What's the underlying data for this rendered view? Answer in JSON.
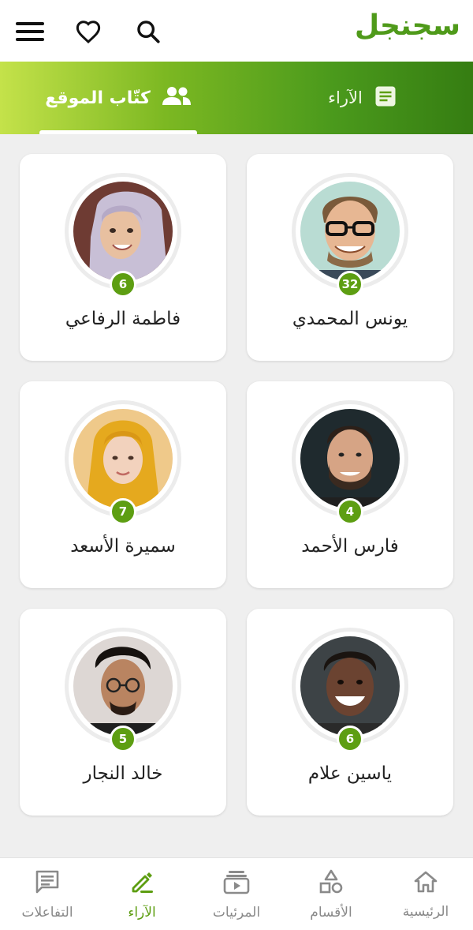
{
  "header": {
    "logo_text": "سجنجل",
    "icons": [
      "search-icon",
      "heart-icon",
      "menu-icon"
    ]
  },
  "tabs": [
    {
      "label": "الآراء",
      "icon": "article-icon",
      "active": false
    },
    {
      "label": "كتّاب الموقع",
      "icon": "people-icon",
      "active": true
    }
  ],
  "writers": [
    {
      "name": "يونس المحمدي",
      "count": "32"
    },
    {
      "name": "فاطمة الرفاعي",
      "count": "6"
    },
    {
      "name": "فارس الأحمد",
      "count": "4"
    },
    {
      "name": "سميرة الأسعد",
      "count": "7"
    },
    {
      "name": "ياسين علام",
      "count": "6"
    },
    {
      "name": "خالد النجار",
      "count": "5"
    }
  ],
  "bottom_nav": [
    {
      "label": "الرئيسية",
      "icon": "home-icon",
      "active": false
    },
    {
      "label": "الأقسام",
      "icon": "categories-icon",
      "active": false
    },
    {
      "label": "المرئيات",
      "icon": "video-icon",
      "active": false
    },
    {
      "label": "الآراء",
      "icon": "pen-icon",
      "active": true
    },
    {
      "label": "التفاعلات",
      "icon": "chat-icon",
      "active": false
    }
  ],
  "colors": {
    "brand_green": "#5d9e12",
    "inactive_gray": "#8a8a8a"
  }
}
